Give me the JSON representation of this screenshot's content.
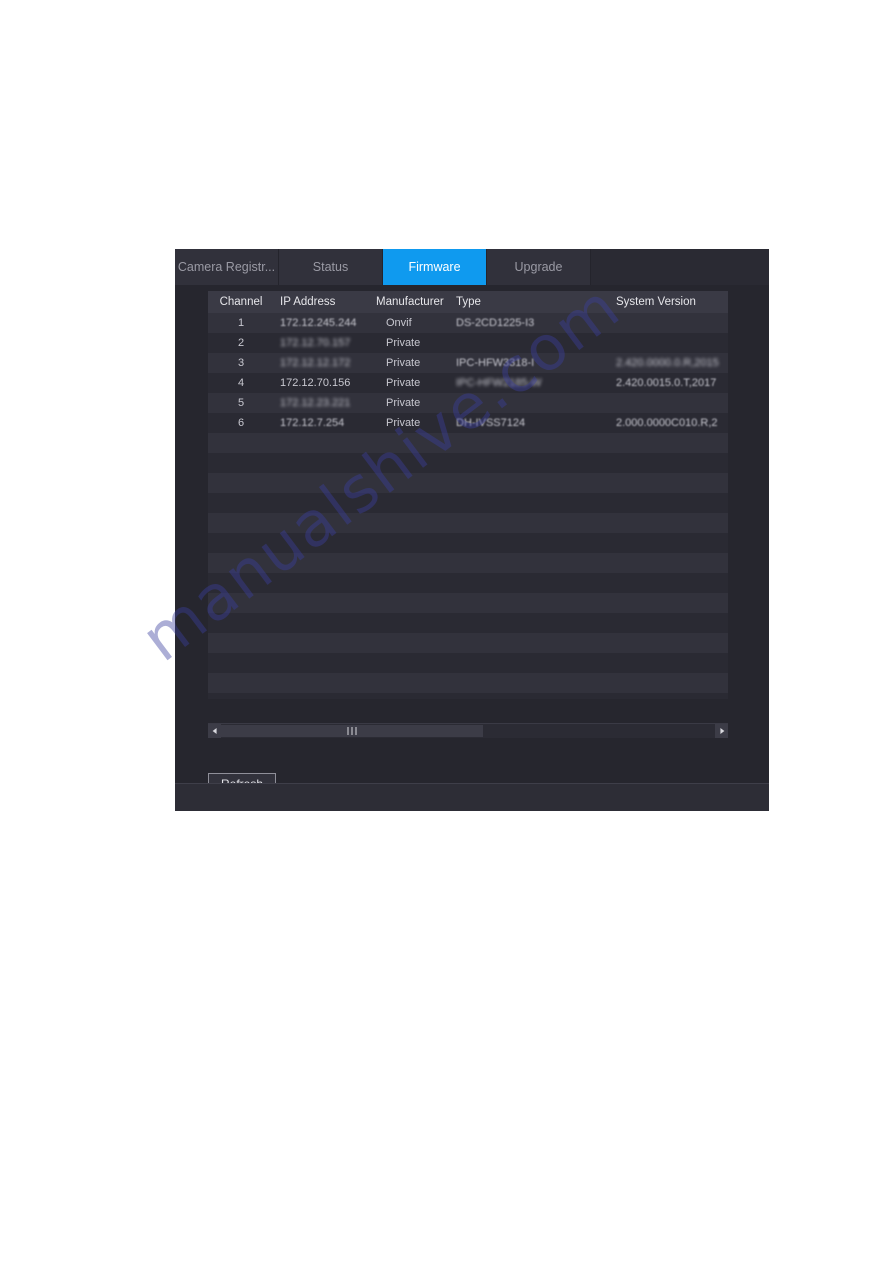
{
  "dialog": {
    "tabs": [
      {
        "label": "Camera Registr...",
        "active": false
      },
      {
        "label": "Status",
        "active": false
      },
      {
        "label": "Firmware",
        "active": true
      },
      {
        "label": "Upgrade",
        "active": false
      }
    ],
    "accent_color": "#0f9aef",
    "background_color": "#26262e"
  },
  "table": {
    "headers": {
      "channel": "Channel",
      "ip_address": "IP Address",
      "manufacturer": "Manufacturer",
      "type": "Type",
      "system_version": "System Version"
    },
    "rows": [
      {
        "channel": "1",
        "ip": "172.12.245.244",
        "manufacturer": "Onvif",
        "type": "DS-2CD1225-I3",
        "version": ""
      },
      {
        "channel": "2",
        "ip": "172.12.70.157",
        "manufacturer": "Private",
        "type": "",
        "version": ""
      },
      {
        "channel": "3",
        "ip": "172.12.12.172",
        "manufacturer": "Private",
        "type": "IPC-HFW3318-I",
        "version": "2.420.0000.0.R,2015"
      },
      {
        "channel": "4",
        "ip": "172.12.70.156",
        "manufacturer": "Private",
        "type": "IPC-HFW2185-W",
        "version": "2.420.0015.0.T,2017"
      },
      {
        "channel": "5",
        "ip": "172.12.23.221",
        "manufacturer": "Private",
        "type": "",
        "version": ""
      },
      {
        "channel": "6",
        "ip": "172.12.7.254",
        "manufacturer": "Private",
        "type": "DH-IVSS7124",
        "version": "2.000.0000C010.R,2"
      }
    ],
    "empty_row_count": 14
  },
  "scrollbar": {
    "left_arrow": "◀",
    "right_arrow": "▶",
    "thumb_position_percent": 0,
    "thumb_width_percent": 53
  },
  "buttons": {
    "refresh": "Refresh"
  },
  "watermark": {
    "text": "manualshive.com"
  }
}
